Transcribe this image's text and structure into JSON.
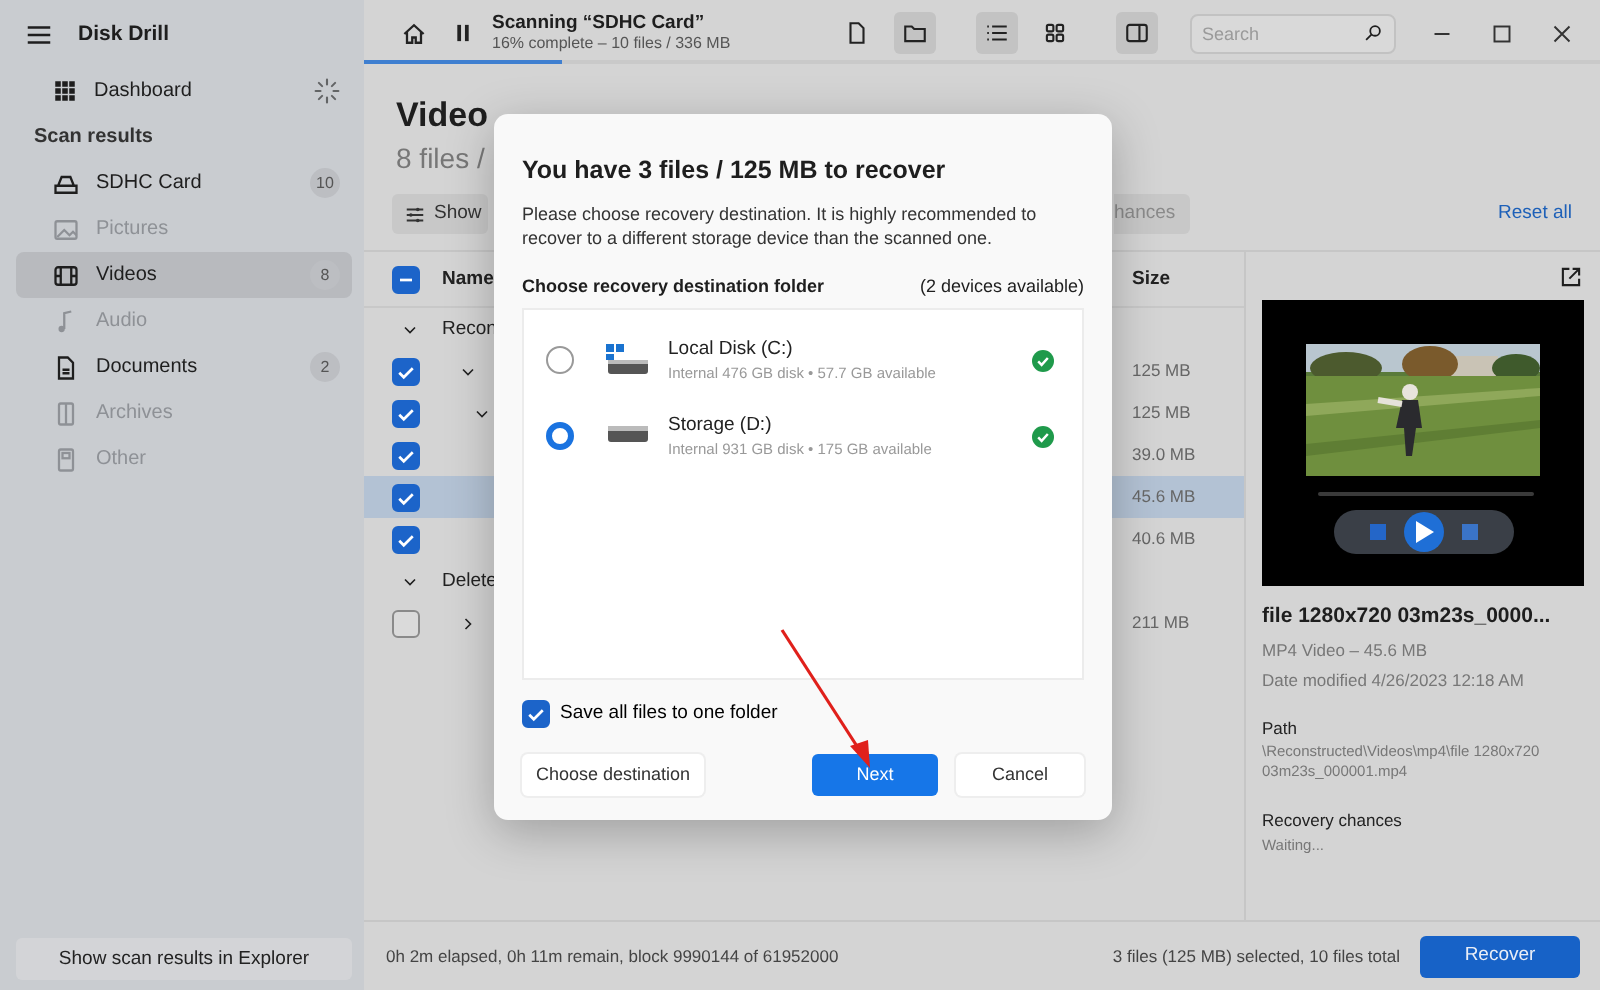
{
  "app": {
    "title": "Disk Drill"
  },
  "sidebar": {
    "dashboard": {
      "label": "Dashboard",
      "busy": true
    },
    "section_title": "Scan results",
    "items": [
      {
        "kind": "drive",
        "label": "SDHC Card",
        "count": "10",
        "selected": false,
        "disabled": false
      },
      {
        "kind": "pictures",
        "label": "Pictures",
        "selected": false,
        "disabled": true
      },
      {
        "kind": "videos",
        "label": "Videos",
        "count": "8",
        "selected": true,
        "disabled": false
      },
      {
        "kind": "audio",
        "label": "Audio",
        "selected": false,
        "disabled": true
      },
      {
        "kind": "documents",
        "label": "Documents",
        "count": "2",
        "selected": false,
        "disabled": false
      },
      {
        "kind": "archives",
        "label": "Archives",
        "selected": false,
        "disabled": true
      },
      {
        "kind": "other",
        "label": "Other",
        "selected": false,
        "disabled": true
      }
    ],
    "footer_button": "Show scan results in Explorer"
  },
  "toolbar": {
    "title": "Scanning “SDHC Card”",
    "subtitle": "16% complete – 10 files / 336 MB",
    "progress": {
      "level": 0.16
    },
    "view_buttons": [
      {
        "kind": "file",
        "selected": false
      },
      {
        "kind": "folder",
        "selected": true
      },
      {
        "kind": "list",
        "selected": true
      },
      {
        "kind": "grid",
        "selected": false
      },
      {
        "kind": "panel",
        "selected": true
      }
    ],
    "search": {
      "placeholder": "Search"
    }
  },
  "content": {
    "title": "Video",
    "subtitle": "8 files /",
    "filter_button": "Show",
    "filter_chip": "hances",
    "reset_link": "Reset all",
    "table": {
      "header_checkbox": {
        "checked": true,
        "indeterminate": true
      },
      "columns": [
        "Name",
        "Size"
      ],
      "groups": [
        {
          "label": "Recon",
          "expanded": true,
          "children": [
            {
              "checked": true,
              "selected": false,
              "size": "125 MB",
              "expanded": true,
              "children": [
                {
                  "checked": true,
                  "selected": false,
                  "size": "125 MB",
                  "expanded": true,
                  "children": [
                    {
                      "checked": true,
                      "selected": false,
                      "size": "39.0 MB"
                    },
                    {
                      "checked": true,
                      "selected": true,
                      "size": "45.6 MB"
                    },
                    {
                      "checked": true,
                      "selected": false,
                      "size": "40.6 MB"
                    }
                  ]
                }
              ]
            }
          ]
        },
        {
          "label": "Delete",
          "expanded": true,
          "children": [
            {
              "checked": false,
              "selected": false,
              "size": "211 MB",
              "expanded": false
            }
          ]
        }
      ]
    }
  },
  "preview": {
    "file_name": "file 1280x720 03m23s_0000...",
    "type_size": "MP4 Video – 45.6 MB",
    "date": "Date modified 4/26/2023 12:18 AM",
    "path_label": "Path",
    "path": "\\Reconstructed\\Videos\\mp4\\file 1280x720 03m23s_000001.mp4",
    "chances_label": "Recovery chances",
    "chances": "Waiting..."
  },
  "dialog": {
    "title": "You have 3 files / 125 MB to recover",
    "description": "Please choose recovery destination. It is highly recommended to recover to a different storage device than the scanned one.",
    "section_label": "Choose recovery destination folder",
    "device_count": "(2 devices available)",
    "devices": [
      {
        "kind": "system",
        "name": "Local Disk (C:)",
        "detail": "Internal 476 GB disk • 57.7 GB available",
        "selected": false,
        "ok": true
      },
      {
        "kind": "drive",
        "name": "Storage (D:)",
        "detail": "Internal 931 GB disk • 175 GB available",
        "selected": true,
        "ok": true
      }
    ],
    "one_folder": {
      "label": "Save all files to one folder",
      "checked": true
    },
    "buttons": [
      {
        "kind": "secondary",
        "label": "Choose destination"
      },
      {
        "kind": "primary",
        "label": "Next"
      },
      {
        "kind": "secondary",
        "label": "Cancel"
      }
    ]
  },
  "status_bar": {
    "progress_text": "0h 2m elapsed, 0h 11m remain, block 9990144 of 61952000",
    "selection_text": "3 files (125 MB) selected, 10 files total",
    "action_button": "Recover"
  }
}
